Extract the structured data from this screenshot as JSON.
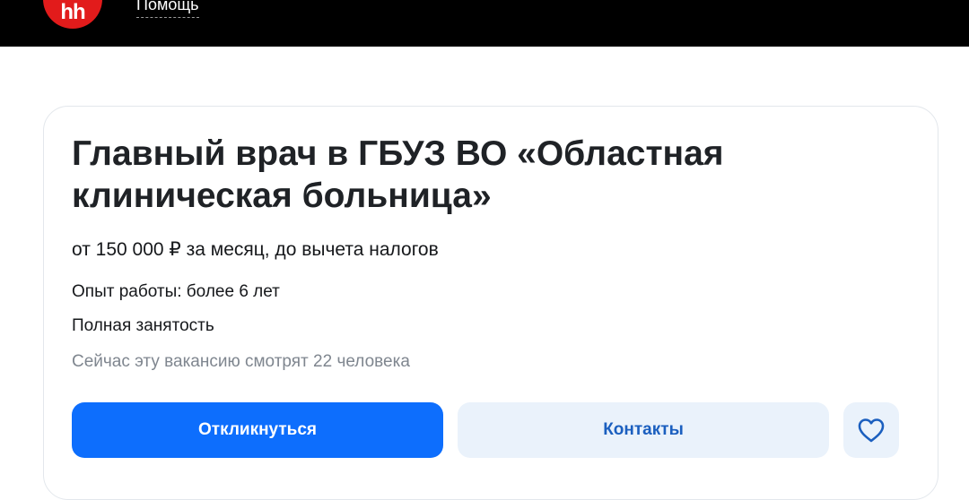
{
  "header": {
    "logo_text": "hh",
    "help_label": "Помощь"
  },
  "vacancy": {
    "title": "Главный врач в ГБУЗ ВО «Областная клиническая больница»",
    "salary": "от 150 000 ₽ за месяц, до вычета налогов",
    "experience": "Опыт работы: более 6 лет",
    "employment": "Полная занятость",
    "viewers": "Сейчас эту вакансию смотрят 22 человека"
  },
  "actions": {
    "apply_label": "Откликнуться",
    "contacts_label": "Контакты",
    "favorite_icon": "heart-outline-icon"
  },
  "colors": {
    "header_bg": "#000000",
    "logo_red": "#e21b1b",
    "primary_button": "#0d6efd",
    "secondary_button": "#eaf2fb",
    "secondary_text": "#1b5fbf",
    "muted_text": "#7f868f"
  }
}
